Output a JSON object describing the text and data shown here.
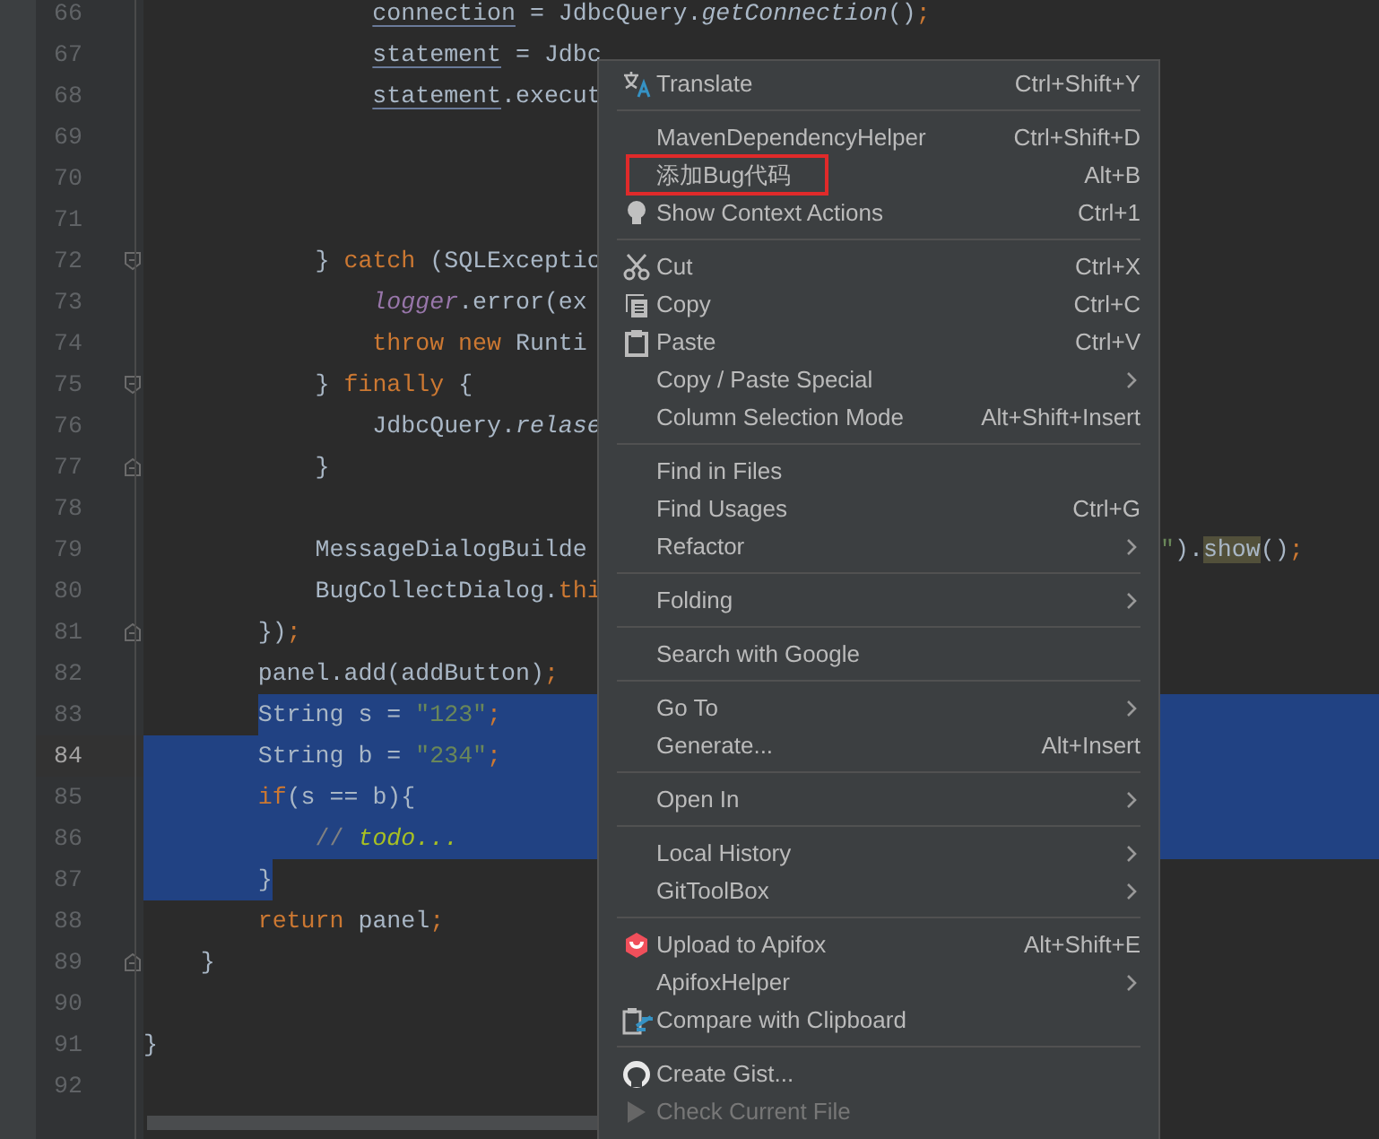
{
  "editor": {
    "lines": [
      {
        "number": "66",
        "kind": "line",
        "segments": [
          {
            "text": "                connection",
            "kind": "under"
          },
          {
            "text": " = JdbcQuery.",
            "kind": "plain"
          },
          {
            "text": "getConnection",
            "kind": "italic"
          },
          {
            "text": "()",
            "kind": "plain"
          },
          {
            "text": ";",
            "kind": "punct"
          }
        ]
      },
      {
        "number": "67",
        "kind": "line",
        "segments": [
          {
            "text": "                statement",
            "kind": "under"
          },
          {
            "text": " = Jdbc",
            "kind": "plain"
          }
        ]
      },
      {
        "number": "68",
        "kind": "line",
        "segments": [
          {
            "text": "                statement",
            "kind": "under"
          },
          {
            "text": ".execut",
            "kind": "plain"
          }
        ]
      },
      {
        "number": "69",
        "kind": "line"
      },
      {
        "number": "70",
        "kind": "line"
      },
      {
        "number": "71",
        "kind": "line"
      },
      {
        "number": "72",
        "kind": "fold-start",
        "segments": [
          {
            "text": "            } ",
            "kind": "plain"
          },
          {
            "text": "catch",
            "kind": "kw"
          },
          {
            "text": " (SQLExceptio",
            "kind": "plain"
          }
        ]
      },
      {
        "number": "73",
        "kind": "line",
        "segments": [
          {
            "text": "                logger",
            "kind": "field"
          },
          {
            "text": ".error(ex",
            "kind": "plain"
          }
        ]
      },
      {
        "number": "74",
        "kind": "line",
        "segments": [
          {
            "text": "                throw new",
            "kind": "kw"
          },
          {
            "text": " Runti",
            "kind": "plain"
          }
        ]
      },
      {
        "number": "75",
        "kind": "fold-start",
        "segments": [
          {
            "text": "            } ",
            "kind": "plain"
          },
          {
            "text": "finally",
            "kind": "kw"
          },
          {
            "text": " {",
            "kind": "plain"
          }
        ]
      },
      {
        "number": "76",
        "kind": "line",
        "segments": [
          {
            "text": "                JdbcQuery.",
            "kind": "plain"
          },
          {
            "text": "relase",
            "kind": "italic"
          }
        ]
      },
      {
        "number": "77",
        "kind": "fold-end",
        "segments": [
          {
            "text": "            }",
            "kind": "plain"
          }
        ]
      },
      {
        "number": "78",
        "kind": "line"
      },
      {
        "number": "79",
        "kind": "line",
        "segments": [
          {
            "text": "            MessageDialogBuilde",
            "kind": "plain"
          }
        ],
        "tail": [
          {
            "text": "\"",
            "kind": "str"
          },
          {
            "text": ").",
            "kind": "plain"
          },
          {
            "text": "show",
            "kind": "hl"
          },
          {
            "text": "()",
            "kind": "plain"
          },
          {
            "text": ";",
            "kind": "punct"
          }
        ]
      },
      {
        "number": "80",
        "kind": "line",
        "segments": [
          {
            "text": "            BugCollectDialog.",
            "kind": "plain"
          },
          {
            "text": "thi",
            "kind": "kw"
          }
        ]
      },
      {
        "number": "81",
        "kind": "fold-end",
        "segments": [
          {
            "text": "        })",
            "kind": "plain"
          },
          {
            "text": ";",
            "kind": "punct"
          }
        ]
      },
      {
        "number": "82",
        "kind": "line",
        "segments": [
          {
            "text": "        panel.add(addButton)",
            "kind": "plain"
          },
          {
            "text": ";",
            "kind": "punct"
          }
        ]
      },
      {
        "number": "83",
        "kind": "line",
        "selected": true,
        "segments": [
          {
            "text": "        String s = ",
            "kind": "plain"
          },
          {
            "text": "\"123\"",
            "kind": "str"
          },
          {
            "text": ";",
            "kind": "punct"
          }
        ]
      },
      {
        "number": "84",
        "kind": "line",
        "current": true,
        "selected": true,
        "segments": [
          {
            "text": "        String b = ",
            "kind": "plain"
          },
          {
            "text": "\"234\"",
            "kind": "str"
          },
          {
            "text": ";",
            "kind": "punct"
          }
        ]
      },
      {
        "number": "85",
        "kind": "line",
        "selected": true,
        "segments": [
          {
            "text": "        if",
            "kind": "kw"
          },
          {
            "text": "(s == b){",
            "kind": "plain"
          }
        ]
      },
      {
        "number": "86",
        "kind": "line",
        "selected": true,
        "segments": [
          {
            "text": "            // ",
            "kind": "comment"
          },
          {
            "text": "todo...",
            "kind": "todo"
          }
        ]
      },
      {
        "number": "87",
        "kind": "line",
        "selected": true,
        "segments": [
          {
            "text": "        }",
            "kind": "plain"
          }
        ]
      },
      {
        "number": "88",
        "kind": "line",
        "segments": [
          {
            "text": "        return",
            "kind": "kw"
          },
          {
            "text": " panel",
            "kind": "plain"
          },
          {
            "text": ";",
            "kind": "punct"
          }
        ]
      },
      {
        "number": "89",
        "kind": "fold-end",
        "segments": [
          {
            "text": "    }",
            "kind": "plain"
          }
        ]
      },
      {
        "number": "90",
        "kind": "line"
      },
      {
        "number": "91",
        "kind": "line",
        "segments": [
          {
            "text": "}",
            "kind": "plain"
          }
        ]
      },
      {
        "number": "92",
        "kind": "line"
      }
    ]
  },
  "context_menu": {
    "items": [
      {
        "kind": "item",
        "label": "Translate",
        "shortcut": "Ctrl+Shift+Y"
      },
      {
        "kind": "separator"
      },
      {
        "kind": "item",
        "label": "MavenDependencyHelper",
        "shortcut": "Ctrl+Shift+D"
      },
      {
        "kind": "item",
        "label": "添加Bug代码",
        "shortcut": "Alt+B",
        "highlighted": true
      },
      {
        "kind": "item",
        "label": "Show Context Actions",
        "shortcut": "Ctrl+1"
      },
      {
        "kind": "separator"
      },
      {
        "kind": "item",
        "label": "Cut",
        "shortcut": "Ctrl+X"
      },
      {
        "kind": "item",
        "label": "Copy",
        "shortcut": "Ctrl+C"
      },
      {
        "kind": "item",
        "label": "Paste",
        "shortcut": "Ctrl+V"
      },
      {
        "kind": "item",
        "label": "Copy / Paste Special",
        "submenu": true
      },
      {
        "kind": "item",
        "label": "Column Selection Mode",
        "shortcut": "Alt+Shift+Insert"
      },
      {
        "kind": "separator"
      },
      {
        "kind": "item",
        "label": "Find in Files"
      },
      {
        "kind": "item",
        "label": "Find Usages",
        "shortcut": "Ctrl+G"
      },
      {
        "kind": "item",
        "label": "Refactor",
        "submenu": true
      },
      {
        "kind": "separator"
      },
      {
        "kind": "item",
        "label": "Folding",
        "submenu": true
      },
      {
        "kind": "separator"
      },
      {
        "kind": "item",
        "label": "Search with Google"
      },
      {
        "kind": "separator"
      },
      {
        "kind": "item",
        "label": "Go To",
        "submenu": true
      },
      {
        "kind": "item",
        "label": "Generate...",
        "shortcut": "Alt+Insert"
      },
      {
        "kind": "separator"
      },
      {
        "kind": "item",
        "label": "Open In",
        "submenu": true
      },
      {
        "kind": "separator"
      },
      {
        "kind": "item",
        "label": "Local History",
        "submenu": true
      },
      {
        "kind": "item",
        "label": "GitToolBox",
        "submenu": true
      },
      {
        "kind": "separator"
      },
      {
        "kind": "item",
        "label": "Upload to Apifox",
        "shortcut": "Alt+Shift+E"
      },
      {
        "kind": "item",
        "label": "ApifoxHelper",
        "submenu": true
      },
      {
        "kind": "item",
        "label": "Compare with Clipboard"
      },
      {
        "kind": "separator"
      },
      {
        "kind": "item",
        "label": "Create Gist..."
      },
      {
        "kind": "item",
        "label": "Check Current File",
        "disabled": true
      }
    ]
  }
}
